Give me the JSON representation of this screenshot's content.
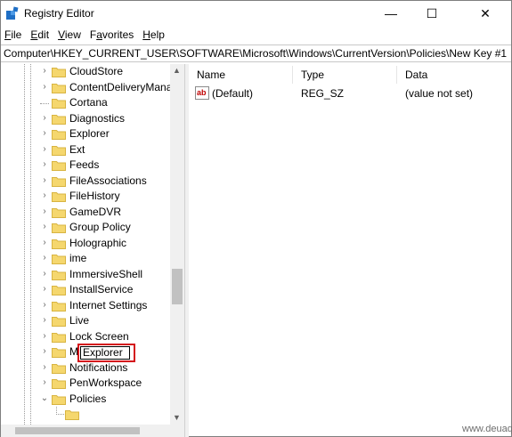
{
  "window": {
    "title": "Registry Editor",
    "minimize_glyph": "—",
    "maximize_glyph": "☐",
    "close_glyph": "✕"
  },
  "menu": [
    {
      "label": "File",
      "mnemonic": "F",
      "rest": "ile"
    },
    {
      "label": "Edit",
      "mnemonic": "E",
      "rest": "dit"
    },
    {
      "label": "View",
      "mnemonic": "V",
      "rest": "iew"
    },
    {
      "label": "Favorites",
      "mnemonic": "a",
      "pre": "F",
      "rest": "vorites"
    },
    {
      "label": "Help",
      "mnemonic": "H",
      "rest": "elp"
    }
  ],
  "address": "Computer\\HKEY_CURRENT_USER\\SOFTWARE\\Microsoft\\Windows\\CurrentVersion\\Policies\\New Key #1",
  "tree": {
    "items": [
      {
        "label": "CloudStore",
        "expander": "›"
      },
      {
        "label": "ContentDeliveryMana",
        "expander": "›"
      },
      {
        "label": "Cortana",
        "expander": ""
      },
      {
        "label": "Diagnostics",
        "expander": "›"
      },
      {
        "label": "Explorer",
        "expander": "›"
      },
      {
        "label": "Ext",
        "expander": "›"
      },
      {
        "label": "Feeds",
        "expander": "›"
      },
      {
        "label": "FileAssociations",
        "expander": "›"
      },
      {
        "label": "FileHistory",
        "expander": "›"
      },
      {
        "label": "GameDVR",
        "expander": "›"
      },
      {
        "label": "Group Policy",
        "expander": "›"
      },
      {
        "label": "Holographic",
        "expander": "›"
      },
      {
        "label": "ime",
        "expander": "›"
      },
      {
        "label": "ImmersiveShell",
        "expander": "›"
      },
      {
        "label": "InstallService",
        "expander": "›"
      },
      {
        "label": "Internet Settings",
        "expander": "›"
      },
      {
        "label": "Live",
        "expander": "›"
      },
      {
        "label": "Lock Screen",
        "expander": "›"
      },
      {
        "label": "Mobility",
        "expander": "›"
      },
      {
        "label": "Notifications",
        "expander": "›"
      },
      {
        "label": "PenWorkspace",
        "expander": "›"
      },
      {
        "label": "Policies",
        "expander": "⌄"
      }
    ],
    "editing_value": "Explorer"
  },
  "values": {
    "columns": [
      "Name",
      "Type",
      "Data"
    ],
    "rows": [
      {
        "icon_text": "ab",
        "name": "(Default)",
        "type": "REG_SZ",
        "data": "(value not set)"
      }
    ]
  },
  "watermark": "www.deuaq.com",
  "colors": {
    "folder": "#f5d76e",
    "folder_edge": "#d8b441",
    "highlight_box": "#d4141b",
    "app_icon": "#1f6fc5"
  }
}
